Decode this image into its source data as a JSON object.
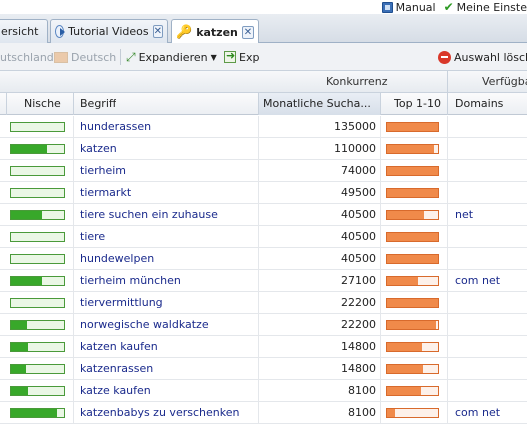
{
  "header": {
    "manual_label": "Manual",
    "settings_label": "Meine Einste"
  },
  "tabs": [
    {
      "label": "ersicht",
      "closable": false,
      "active": false
    },
    {
      "label": "Tutorial Videos",
      "closable": true,
      "active": false
    },
    {
      "label": "katzen",
      "closable": true,
      "active": true
    }
  ],
  "toolbar": {
    "country": "utschland",
    "language": "Deutsch",
    "expand": "Expandieren",
    "export": "Exp",
    "remove_selection": "Auswahl lösch"
  },
  "groups": {
    "competition": "Konkurrenz",
    "availability": "Verfügba"
  },
  "columns": {
    "niche": "Nische",
    "term": "Begriff",
    "monthly_searches": "Monatliche Sucha...",
    "top10": "Top 1-10",
    "domains": "Domains"
  },
  "rows": [
    {
      "term": "hunderassen",
      "searches": "135000",
      "niche": 0.0,
      "top10": 1.0,
      "domains": ""
    },
    {
      "term": "katzen",
      "searches": "110000",
      "niche": 0.68,
      "top10": 0.92,
      "domains": ""
    },
    {
      "term": "tierheim",
      "searches": "74000",
      "niche": 0.0,
      "top10": 1.0,
      "domains": ""
    },
    {
      "term": "tiermarkt",
      "searches": "49500",
      "niche": 0.0,
      "top10": 1.0,
      "domains": ""
    },
    {
      "term": "tiere suchen ein zuhause",
      "searches": "40500",
      "niche": 0.58,
      "top10": 0.72,
      "domains": "net"
    },
    {
      "term": "tiere",
      "searches": "40500",
      "niche": 0.0,
      "top10": 1.0,
      "domains": ""
    },
    {
      "term": "hundewelpen",
      "searches": "40500",
      "niche": 0.0,
      "top10": 1.0,
      "domains": ""
    },
    {
      "term": "tierheim münchen",
      "searches": "27100",
      "niche": 0.58,
      "top10": 0.6,
      "domains": "com net"
    },
    {
      "term": "tiervermittlung",
      "searches": "22200",
      "niche": 0.0,
      "top10": 1.0,
      "domains": ""
    },
    {
      "term": "norwegische waldkatze",
      "searches": "22200",
      "niche": 0.3,
      "top10": 0.96,
      "domains": ""
    },
    {
      "term": "katzen kaufen",
      "searches": "14800",
      "niche": 0.32,
      "top10": 0.68,
      "domains": ""
    },
    {
      "term": "katzenrassen",
      "searches": "14800",
      "niche": 0.28,
      "top10": 0.7,
      "domains": ""
    },
    {
      "term": "katze kaufen",
      "searches": "8100",
      "niche": 0.32,
      "top10": 0.66,
      "domains": ""
    },
    {
      "term": "katzenbabys zu verschenken",
      "searches": "8100",
      "niche": 0.86,
      "top10": 0.16,
      "domains": "com net"
    }
  ]
}
